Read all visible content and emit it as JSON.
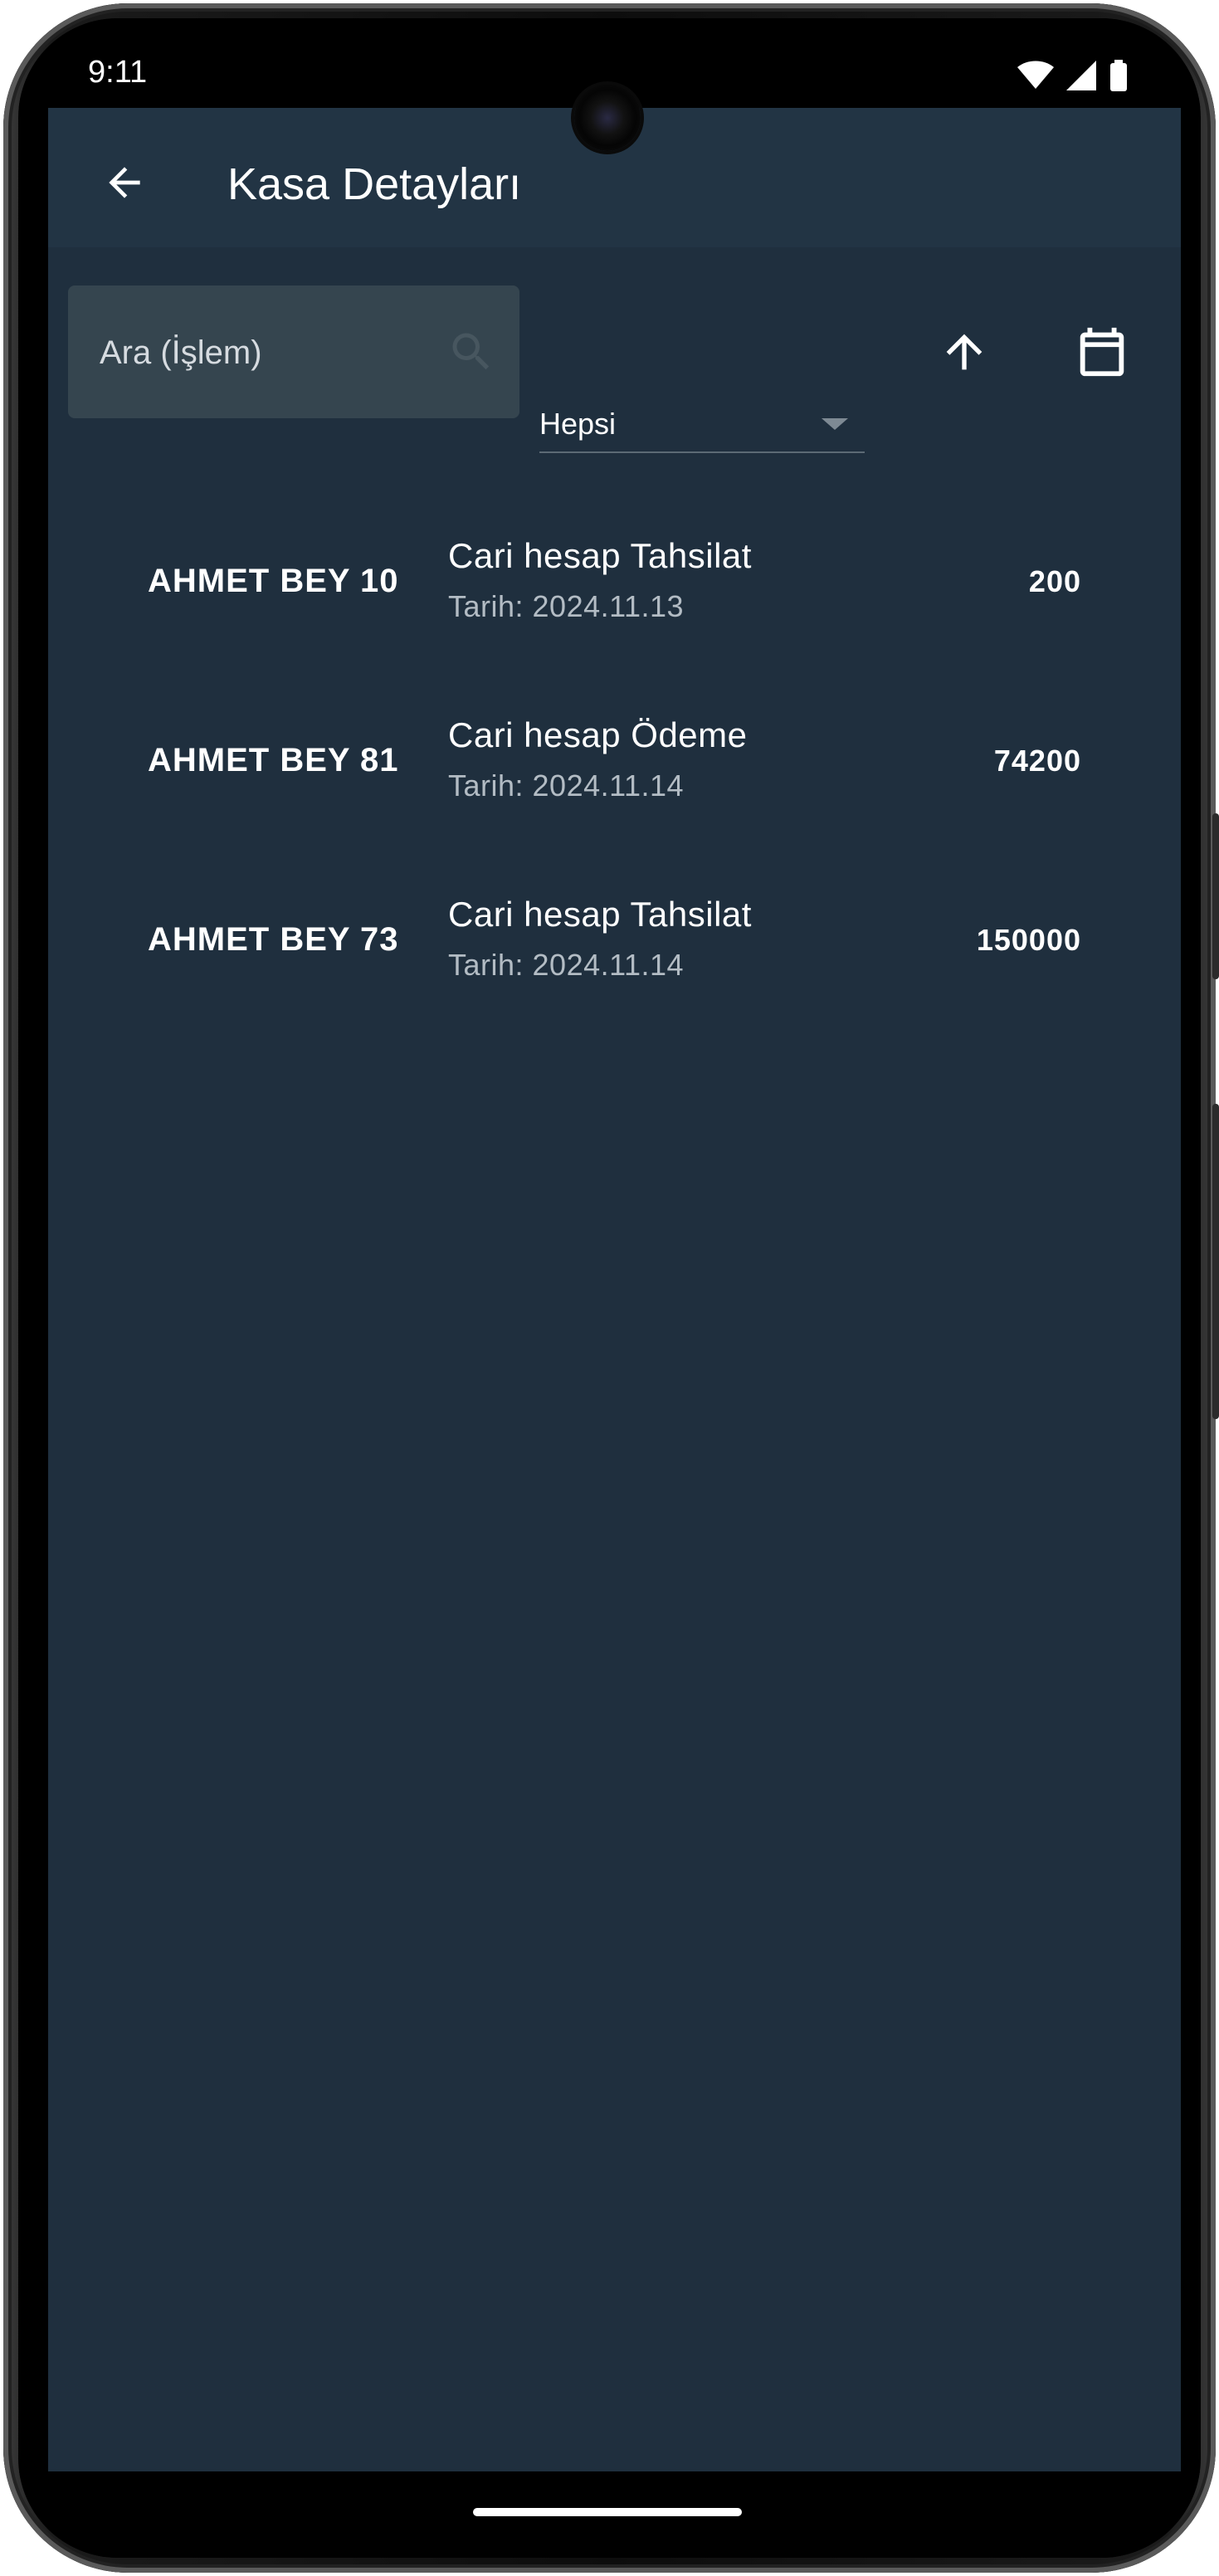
{
  "status_bar": {
    "time": "9:11",
    "icons": [
      "wifi-icon",
      "signal-icon",
      "battery-icon"
    ]
  },
  "app_bar": {
    "title": "Kasa Detayları",
    "back_icon": "arrow-back-icon"
  },
  "search": {
    "placeholder": "Ara (İşlem)",
    "value": "",
    "icon": "search-icon"
  },
  "filter": {
    "selected": "Hepsi"
  },
  "actions": {
    "sort_icon": "arrow-up-icon",
    "calendar_icon": "calendar-icon"
  },
  "transactions": [
    {
      "name": "AHMET BEY 10",
      "type": "Cari hesap Tahsilat",
      "date": "Tarih: 2024.11.13",
      "amount": "200"
    },
    {
      "name": "AHMET BEY 81",
      "type": "Cari hesap Ödeme",
      "date": "Tarih: 2024.11.14",
      "amount": "74200"
    },
    {
      "name": "AHMET BEY 73",
      "type": "Cari hesap Tahsilat",
      "date": "Tarih: 2024.11.14",
      "amount": "150000"
    }
  ],
  "colors": {
    "background": "#1f2f3e",
    "app_bar": "#223444",
    "search_field": "#35454f",
    "secondary_text": "#b3bcc4"
  }
}
